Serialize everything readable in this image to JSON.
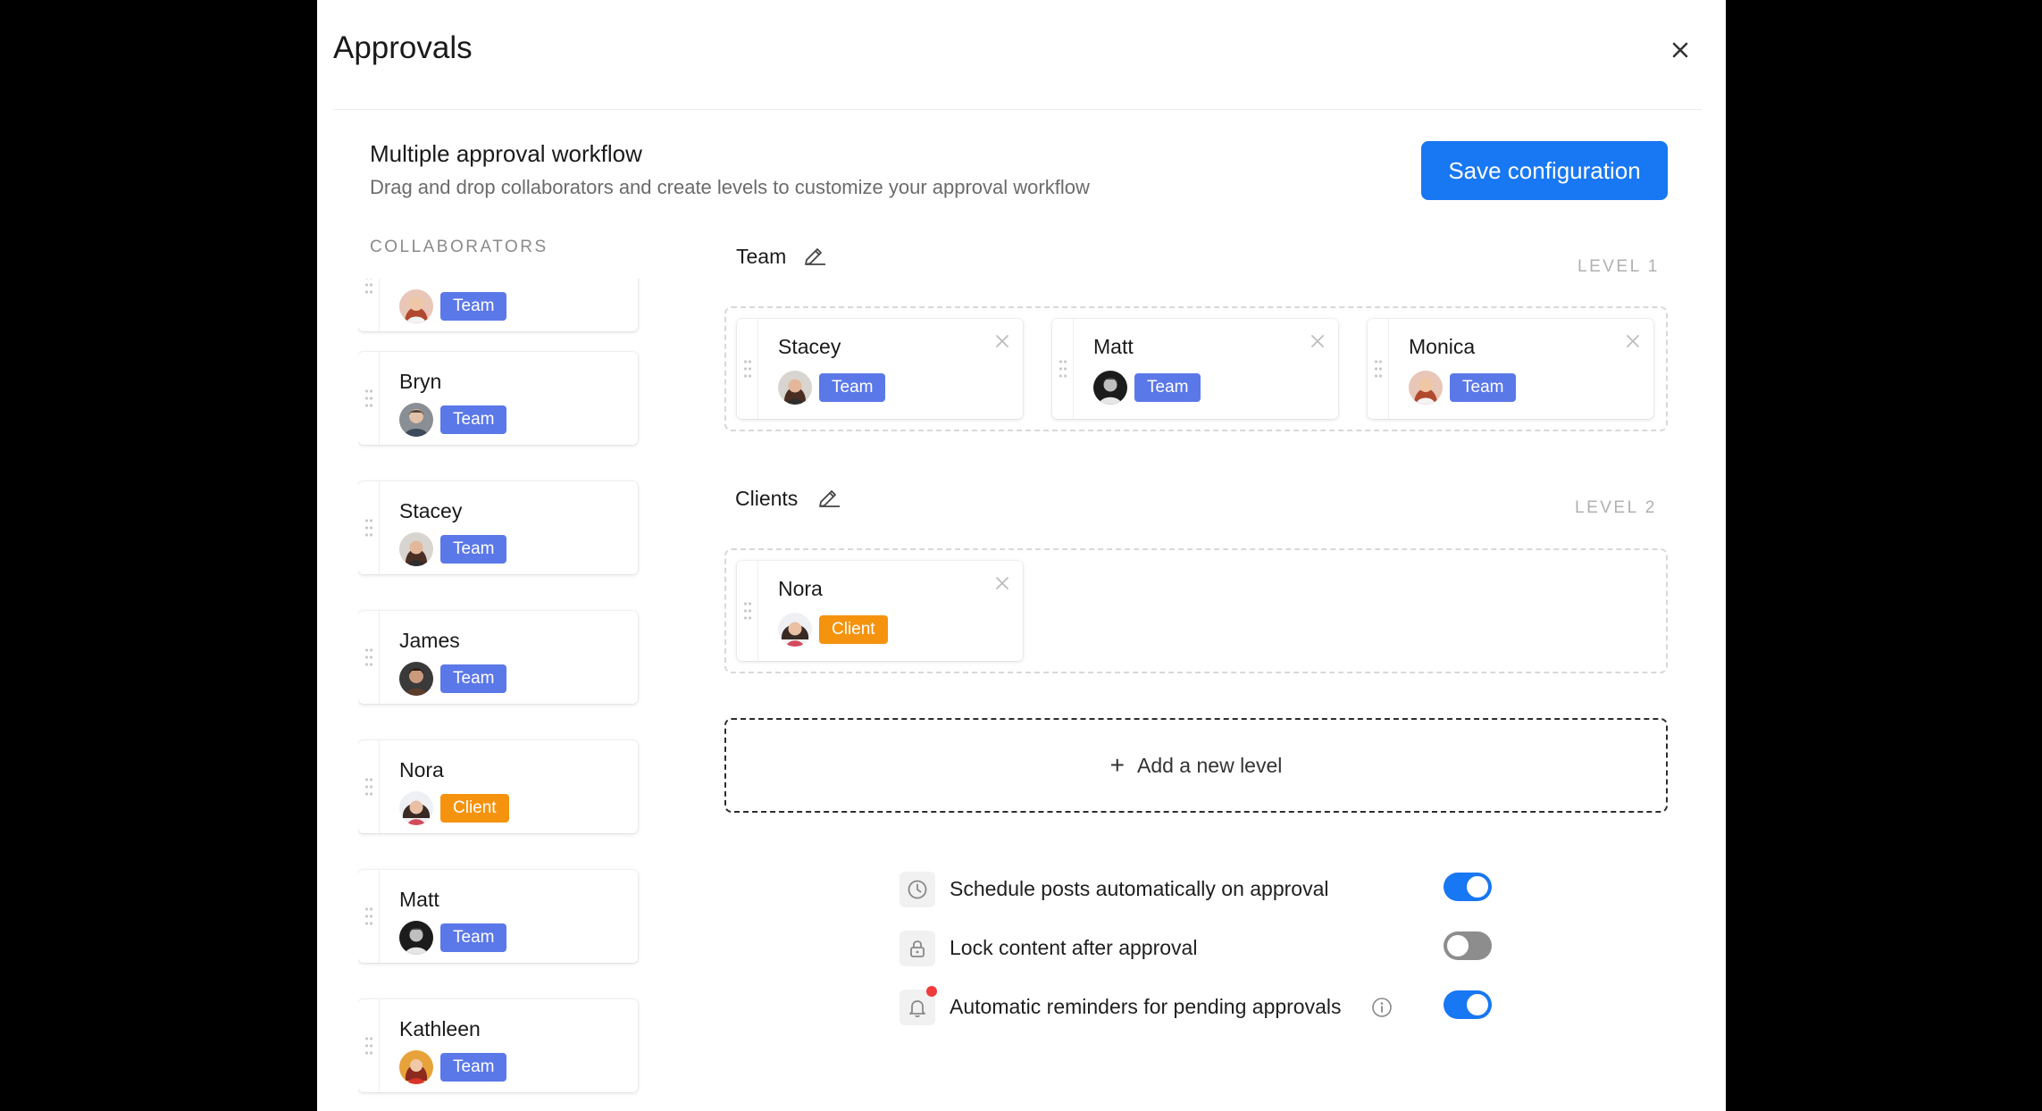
{
  "modal": {
    "title": "Approvals"
  },
  "workflow": {
    "title": "Multiple approval workflow",
    "description": "Drag and drop collaborators and create levels to customize your approval workflow",
    "save_label": "Save configuration"
  },
  "collaborators": {
    "heading": "COLLABORATORS",
    "items": [
      {
        "name": "",
        "role": "Team"
      },
      {
        "name": "Bryn",
        "role": "Team"
      },
      {
        "name": "Stacey",
        "role": "Team"
      },
      {
        "name": "James",
        "role": "Team"
      },
      {
        "name": "Nora",
        "role": "Client"
      },
      {
        "name": "Matt",
        "role": "Team"
      },
      {
        "name": "Kathleen",
        "role": "Team"
      }
    ]
  },
  "levels": [
    {
      "name": "Team",
      "tag": "LEVEL 1",
      "members": [
        {
          "name": "Stacey",
          "role": "Team"
        },
        {
          "name": "Matt",
          "role": "Team"
        },
        {
          "name": "Monica",
          "role": "Team"
        }
      ]
    },
    {
      "name": "Clients",
      "tag": "LEVEL 2",
      "members": [
        {
          "name": "Nora",
          "role": "Client"
        }
      ]
    }
  ],
  "add_level_label": "Add a new level",
  "settings": [
    {
      "label": "Schedule posts automatically on approval",
      "icon": "clock-icon",
      "enabled": true
    },
    {
      "label": "Lock content after approval",
      "icon": "lock-icon",
      "enabled": false
    },
    {
      "label": "Automatic reminders for pending approvals",
      "icon": "bell-icon",
      "enabled": true,
      "has_info": true,
      "has_notification_dot": true
    }
  ],
  "colors": {
    "accent": "#1877f2",
    "team_badge": "#5b78e8",
    "client_badge": "#f5930f",
    "notification_dot": "#ef3b3b"
  }
}
